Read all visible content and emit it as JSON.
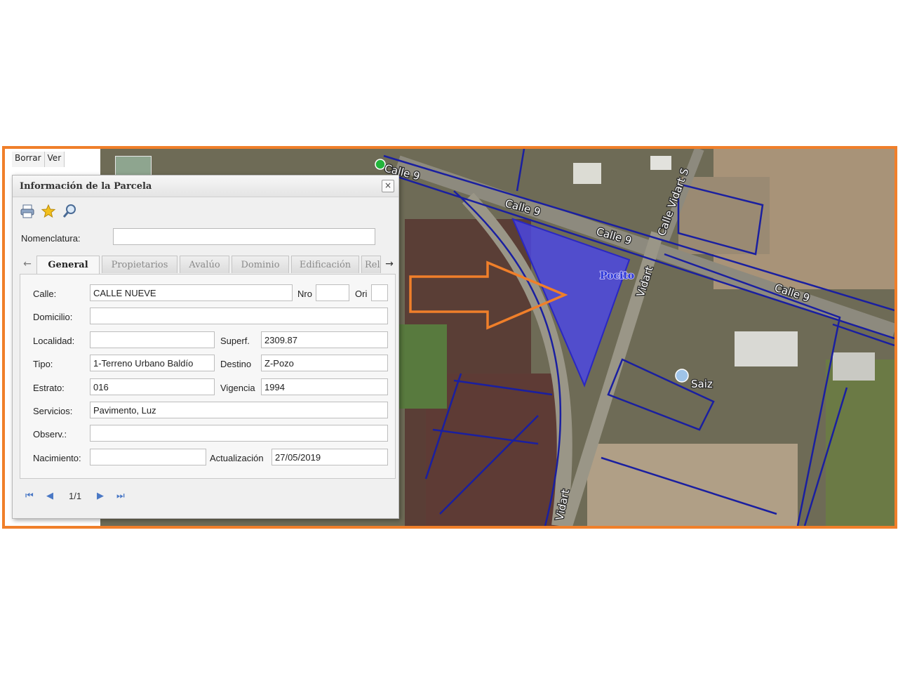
{
  "toolbar": {
    "borrar": "Borrar",
    "ver": "Ver"
  },
  "dialog": {
    "title": "Información de la Parcela",
    "close": "×"
  },
  "icons": [
    "printer-icon",
    "star-icon",
    "magnifier-icon"
  ],
  "nomenclatura": {
    "label": "Nomenclatura:",
    "value": ""
  },
  "tabs": [
    {
      "label": "General",
      "active": true
    },
    {
      "label": "Propietarios"
    },
    {
      "label": "Avalúo"
    },
    {
      "label": "Dominio"
    },
    {
      "label": "Edificación"
    },
    {
      "label": "Rel"
    }
  ],
  "form": {
    "calle_label": "Calle:",
    "calle": "CALLE NUEVE",
    "nro_label": "Nro",
    "nro": "",
    "ori_label": "Ori",
    "ori": "",
    "domicilio_label": "Domicilio:",
    "domicilio": "",
    "localidad_label": "Localidad:",
    "localidad": "",
    "superf_label": "Superf.",
    "superf": "2309.87",
    "tipo_label": "Tipo:",
    "tipo": "1-Terreno Urbano Baldío",
    "destino_label": "Destino",
    "destino": "Z-Pozo",
    "estrato_label": "Estrato:",
    "estrato": "016",
    "vigencia_label": "Vigencia",
    "vigencia": "1994",
    "servicios_label": "Servicios:",
    "servicios": "Pavimento, Luz",
    "observ_label": "Observ.:",
    "observ": "",
    "nacimiento_label": "Nacimiento:",
    "nacimiento": "",
    "actualizacion_label": "Actualización",
    "actualizacion": "27/05/2019"
  },
  "pager": {
    "page": "1/1"
  },
  "map": {
    "labels": {
      "calle9_a": "Calle 9",
      "calle9_b": "Calle 9",
      "calle9_c": "Calle 9",
      "calle9_d": "Calle 9",
      "vidart_s": "Calle Vidart S",
      "vidart_a": "Vidart",
      "vidart_b": "Vidart",
      "pocito": "Pocito",
      "saiz": "Saiz"
    },
    "colors": {
      "frame": "#f07f2a",
      "parcel_fill": "#4b47e6",
      "parcel_lines": "#1a1fa0",
      "arrow": "#f07f2a"
    }
  }
}
